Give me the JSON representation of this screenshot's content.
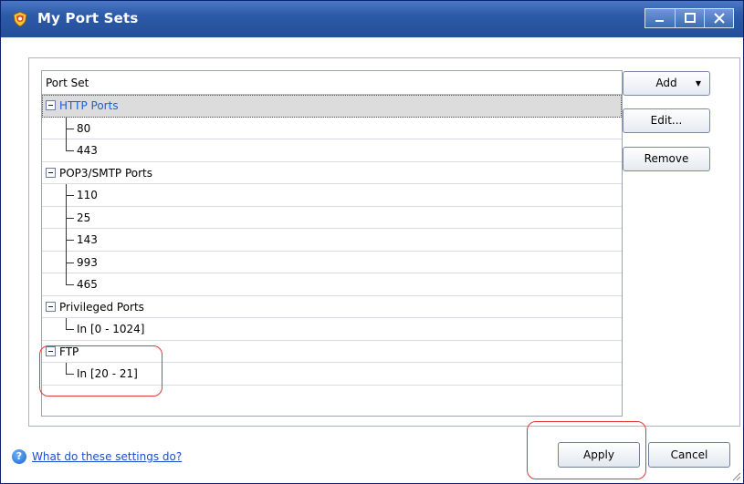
{
  "window": {
    "title": "My Port Sets"
  },
  "caption_buttons": {
    "minimize": "_",
    "maximize": "□",
    "close": "X"
  },
  "tree": {
    "header": "Port Set",
    "groups": [
      {
        "label": "HTTP Ports",
        "selected": true,
        "children": [
          "80",
          "443"
        ]
      },
      {
        "label": "POP3/SMTP Ports",
        "selected": false,
        "children": [
          "110",
          "25",
          "143",
          "993",
          "465"
        ]
      },
      {
        "label": "Privileged Ports",
        "selected": false,
        "children": [
          "In [0 - 1024]"
        ]
      },
      {
        "label": "FTP",
        "selected": false,
        "children": [
          "In [20 - 21]"
        ]
      }
    ]
  },
  "side_buttons": {
    "add": "Add",
    "add_caret": "▼",
    "edit": "Edit...",
    "remove": "Remove"
  },
  "help": {
    "icon": "?",
    "link": "What do these settings do?"
  },
  "footer": {
    "apply": "Apply",
    "cancel": "Cancel"
  },
  "colors": {
    "titlebar": "#2c5aa8",
    "selected_text": "#1a5fd6",
    "annotation": "#e03a3a",
    "link": "#1a4fd0"
  }
}
